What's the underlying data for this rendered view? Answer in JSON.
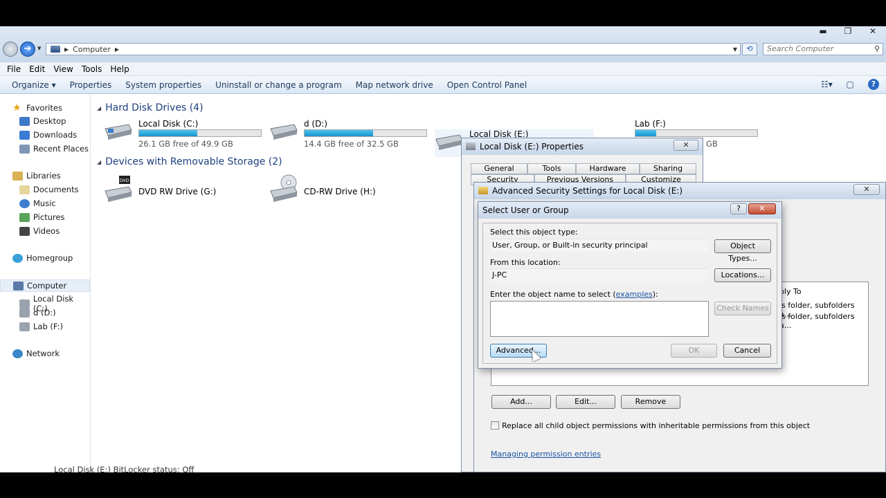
{
  "window": {
    "minimize": "▬",
    "maximize": "❐",
    "close": "✕"
  },
  "address": {
    "path": "Computer",
    "search_placeholder": "Search Computer"
  },
  "menu": [
    "File",
    "Edit",
    "View",
    "Tools",
    "Help"
  ],
  "commands": [
    "Organize ▾",
    "Properties",
    "System properties",
    "Uninstall or change a program",
    "Map network drive",
    "Open Control Panel"
  ],
  "nav": {
    "favorites": "Favorites",
    "favorites_items": [
      "Desktop",
      "Downloads",
      "Recent Places"
    ],
    "libraries": "Libraries",
    "libraries_items": [
      "Documents",
      "Music",
      "Pictures",
      "Videos"
    ],
    "homegroup": "Homegroup",
    "computer": "Computer",
    "computer_items": [
      "Local Disk (C:)",
      "d (D:)",
      "Lab (F:)"
    ],
    "network": "Network"
  },
  "groups": {
    "hdd": "Hard Disk Drives (4)",
    "removable": "Devices with Removable Storage (2)"
  },
  "drives": [
    {
      "name": "Local Disk (C:)",
      "free": "26.1 GB free of 49.9 GB",
      "used_fraction": 0.48
    },
    {
      "name": "d (D:)",
      "free": "14.4 GB free of 32.5 GB",
      "used_fraction": 0.56
    },
    {
      "name": "Local Disk (E:)",
      "free": "",
      "used_fraction": 0.0
    },
    {
      "name": "Lab (F:)",
      "free": "GB",
      "used_fraction": 0.17
    }
  ],
  "removable": [
    {
      "name": "DVD RW Drive (G:)",
      "badge": "DVD"
    },
    {
      "name": "CD-RW Drive (H:)",
      "badge": ""
    }
  ],
  "status_text": "Local Disk (E:)  BitLocker status: Off",
  "properties": {
    "title": "Local Disk (E:) Properties",
    "tabs_row1": [
      "General",
      "Tools",
      "Hardware",
      "Sharing"
    ],
    "tabs_row2": [
      "Security",
      "Previous Versions",
      "Customize"
    ]
  },
  "advanced": {
    "title": "Advanced Security Settings for Local Disk (E:)",
    "col_apply_to": "ply To",
    "rows": [
      "is folder, subfolders a...",
      "is folder, subfolders a..."
    ],
    "add": "Add...",
    "edit": "Edit...",
    "remove": "Remove",
    "replace_label": "Replace all child object permissions with inheritable permissions from this object",
    "link": "Managing permission entries"
  },
  "select": {
    "title": "Select User or Group",
    "help": "?",
    "close": "✕",
    "object_type_label": "Select this object type:",
    "object_type_value": "User, Group, or Built-in security principal",
    "object_types_btn": "Object Types...",
    "location_label": "From this location:",
    "location_value": "J-PC",
    "locations_btn": "Locations...",
    "enter_label_pre": "Enter the object name to select (",
    "enter_label_link": "examples",
    "enter_label_post": "):",
    "check_names_btn": "Check Names",
    "advanced_btn": "Advanced...",
    "ok_btn": "OK",
    "cancel_btn": "Cancel"
  }
}
